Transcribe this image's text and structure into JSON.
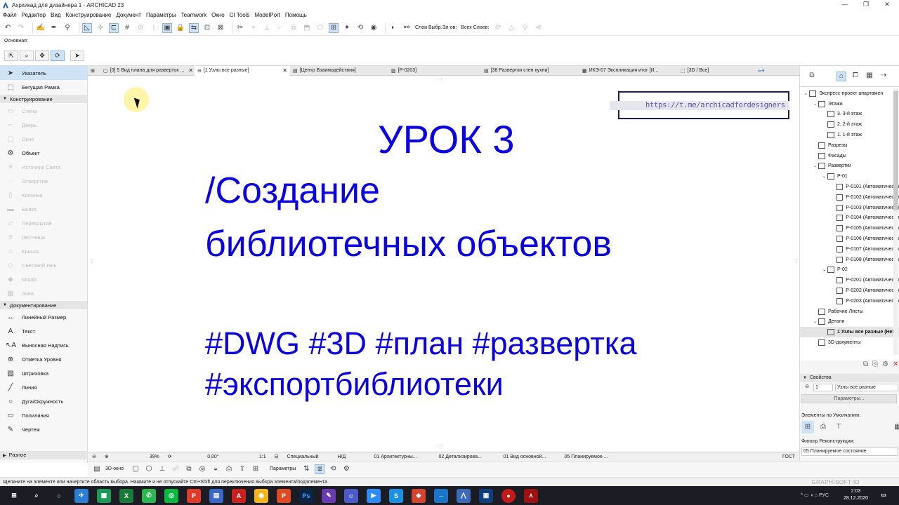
{
  "window": {
    "title": "Ахрхикад для дизайнера 1 - ARCHICAD 23",
    "minimize": "—",
    "restore": "❐",
    "close": "✕"
  },
  "menu": [
    "Файл",
    "Редактор",
    "Вид",
    "Конструирование",
    "Документ",
    "Параметры",
    "Teamwork",
    "Окно",
    "CI Tools",
    "ModelPort",
    "Помощь"
  ],
  "toolbar": {
    "layers_label_1": "Слои Выбр.Эл-ов:",
    "layers_label_2": "Всех Слоев:"
  },
  "infobox": {
    "label": "Основная:"
  },
  "toolbox": {
    "top": [
      {
        "label": "Указатель",
        "icon": "arrow-icon",
        "glyph": "➤",
        "state": "selected"
      },
      {
        "label": "Бегущая Рамка",
        "icon": "marquee-icon",
        "glyph": "⬚",
        "state": "normal"
      }
    ],
    "design_category": "Конструирование",
    "design": [
      {
        "label": "Стена",
        "glyph": "▭",
        "state": "disabled"
      },
      {
        "label": "Дверь",
        "glyph": "⌐",
        "state": "disabled"
      },
      {
        "label": "Окно",
        "glyph": "▢",
        "state": "disabled"
      },
      {
        "label": "Объект",
        "glyph": "⚙",
        "state": "normal"
      },
      {
        "label": "Источник Света",
        "glyph": "☀",
        "state": "disabled"
      },
      {
        "label": "Отверстие",
        "glyph": "◌",
        "state": "disabled"
      },
      {
        "label": "Колонна",
        "glyph": "▯",
        "state": "disabled"
      },
      {
        "label": "Балка",
        "glyph": "▬",
        "state": "disabled"
      },
      {
        "label": "Перекрытие",
        "glyph": "▱",
        "state": "disabled"
      },
      {
        "label": "Лестница",
        "glyph": "≡",
        "state": "disabled"
      },
      {
        "label": "Крыша",
        "glyph": "⌂",
        "state": "disabled"
      },
      {
        "label": "Световой Люк",
        "glyph": "◇",
        "state": "disabled"
      },
      {
        "label": "Морф",
        "glyph": "◆",
        "state": "disabled"
      },
      {
        "label": "Зона",
        "glyph": "▦",
        "state": "disabled"
      }
    ],
    "doc_category": "Документирование",
    "doc": [
      {
        "label": "Линейный Размер",
        "glyph": "↔",
        "state": "normal"
      },
      {
        "label": "Текст",
        "glyph": "A",
        "state": "normal"
      },
      {
        "label": "Выносная Надпись",
        "glyph": "↖A",
        "state": "normal"
      },
      {
        "label": "Отметка Уровня",
        "glyph": "⊕",
        "state": "normal"
      },
      {
        "label": "Штриховка",
        "glyph": "▧",
        "state": "normal"
      },
      {
        "label": "Линия",
        "glyph": "╱",
        "state": "normal"
      },
      {
        "label": "Дуга/Окружность",
        "glyph": "○",
        "state": "normal"
      },
      {
        "label": "Полилиния",
        "glyph": "▭",
        "state": "normal"
      },
      {
        "label": "Чертеж",
        "glyph": "✎",
        "state": "normal"
      }
    ],
    "other_category": "Разное"
  },
  "tabs": [
    {
      "label": "[0] 5 Вид плана для разверток ...",
      "active": false,
      "close": true
    },
    {
      "label": "[1 Узлы все разные]",
      "active": true,
      "close": true
    },
    {
      "label": "[Центр Взаимодействия]",
      "active": false,
      "close": false
    },
    {
      "label": "[Р-0203]",
      "active": false,
      "close": false
    },
    {
      "label": "[38 Развертки стен кухни]",
      "active": false,
      "close": false
    },
    {
      "label": "ИКЭ-07 Экспликация итог [И...",
      "active": false,
      "close": false
    },
    {
      "label": "[3D / Все]",
      "active": false,
      "close": false
    }
  ],
  "canvas": {
    "url": "https://t.me/archicadfordesigners",
    "lines": [
      "УРОК 3",
      "/Создание",
      "библиотечных объектов",
      "#DWG #3D #план #развертка",
      "#экспортбиблиотеки"
    ],
    "text_color": "#0a00e6"
  },
  "status": {
    "zoom": "39%",
    "angle": "0,00°",
    "scale": "1:1",
    "view": "Специальный",
    "nd": "Н/Д",
    "layer1": "01 Архитектурны...",
    "layer2": "02 Детализирова...",
    "layer3": "01 Вид основной...",
    "layer4": "05 Планируемое ...",
    "std": "ГОСТ"
  },
  "bottom": {
    "view_3d": "3D-окно",
    "params": "Параметры"
  },
  "hint": {
    "text": "Щелкните на элементе или начертите область выбора. Нажмите и не отпускайте Ctrl+Shift для переключения выбора элемента/подэлемента.",
    "brand": "GRAPHISOFT ID"
  },
  "navigator": {
    "items": [
      {
        "label": "Экспресс-проект апартамен",
        "depth": 0,
        "toggle": "⌄",
        "sel": false
      },
      {
        "label": "Этажи",
        "depth": 1,
        "toggle": "⌄",
        "sel": false
      },
      {
        "label": "3. 3-й этаж",
        "depth": 2,
        "toggle": "",
        "sel": false
      },
      {
        "label": "2. 2-й этаж",
        "depth": 2,
        "toggle": "",
        "sel": false
      },
      {
        "label": "1. 1-й этаж",
        "depth": 2,
        "toggle": "",
        "sel": false
      },
      {
        "label": "Разрезы",
        "depth": 1,
        "toggle": "",
        "sel": false
      },
      {
        "label": "Фасады",
        "depth": 1,
        "toggle": "",
        "sel": false
      },
      {
        "label": "Развертки",
        "depth": 1,
        "toggle": "⌄",
        "sel": false
      },
      {
        "label": "Р-01",
        "depth": 2,
        "toggle": "⌄",
        "sel": false
      },
      {
        "label": "Р-0101 (Автоматически",
        "depth": 3,
        "toggle": "",
        "sel": false
      },
      {
        "label": "Р-0102 (Автоматически",
        "depth": 3,
        "toggle": "",
        "sel": false
      },
      {
        "label": "Р-0103 (Автоматически",
        "depth": 3,
        "toggle": "",
        "sel": false
      },
      {
        "label": "Р-0104 (Автоматически",
        "depth": 3,
        "toggle": "",
        "sel": false
      },
      {
        "label": "Р-0105 (Автоматически",
        "depth": 3,
        "toggle": "",
        "sel": false
      },
      {
        "label": "Р-0106 (Автоматически",
        "depth": 3,
        "toggle": "",
        "sel": false
      },
      {
        "label": "Р-0107 (Автоматически",
        "depth": 3,
        "toggle": "",
        "sel": false
      },
      {
        "label": "Р-0108 (Автоматически",
        "depth": 3,
        "toggle": "",
        "sel": false
      },
      {
        "label": "Р-02",
        "depth": 2,
        "toggle": "⌄",
        "sel": false
      },
      {
        "label": "Р-0201 (Автоматически",
        "depth": 3,
        "toggle": "",
        "sel": false
      },
      {
        "label": "Р-0202 (Автоматически",
        "depth": 3,
        "toggle": "",
        "sel": false
      },
      {
        "label": "Р-0203 (Автоматически",
        "depth": 3,
        "toggle": "",
        "sel": false
      },
      {
        "label": "Рабочие Листы",
        "depth": 1,
        "toggle": "",
        "sel": false
      },
      {
        "label": "Детали",
        "depth": 1,
        "toggle": "⌄",
        "sel": false
      },
      {
        "label": "1 Узлы все разные (Неза",
        "depth": 2,
        "toggle": "",
        "sel": true
      },
      {
        "label": "3D-документы",
        "depth": 1,
        "toggle": "",
        "sel": false
      }
    ]
  },
  "properties": {
    "header": "Свойства",
    "id": "1",
    "name": "Узлы все разные",
    "params_button": "Параметры...",
    "defaults_label": "Элементы по Умолчанию:",
    "filter_label": "Фильтр Реконструкции:",
    "filter_value": "05 Планируемое состояние"
  },
  "taskbar": {
    "time": "2:03",
    "date": "28.12.2020",
    "lang": "РУС"
  }
}
